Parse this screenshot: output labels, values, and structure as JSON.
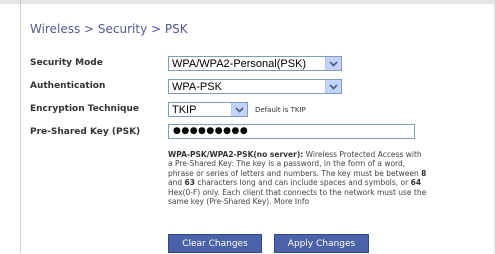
{
  "breadcrumb": {
    "text": "Wireless > Security > PSK"
  },
  "form": {
    "security_mode": {
      "label": "Security Mode",
      "value": "WPA/WPA2-Personal(PSK)"
    },
    "authentication": {
      "label": "Authentication",
      "value": "WPA-PSK"
    },
    "encryption": {
      "label": "Encryption Technique",
      "value": "TKIP",
      "note": "Default is TKIP"
    },
    "psk": {
      "label": "Pre-Shared Key (PSK)",
      "value": "●●●●●●●●●"
    }
  },
  "description": {
    "title": "WPA-PSK/WPA2-PSK(no server):",
    "text_a": " Wireless Protected Access with a Pre-Shared Key: The key is a password, in the form of a word, phrase or series of letters and numbers. The key must be between ",
    "num8": "8",
    "text_b": " and ",
    "num63": "63",
    "text_c": " characters long and can include spaces and symbols, or ",
    "num64": "64",
    "text_d": " Hex(0-F) only. Each client that connects to the network must use the same key (Pre-Shared Key). More Info"
  },
  "buttons": {
    "clear": "Clear Changes",
    "apply": "Apply Changes"
  },
  "colors": {
    "accent": "#4a63a8",
    "breadcrumb": "#505a8c"
  }
}
